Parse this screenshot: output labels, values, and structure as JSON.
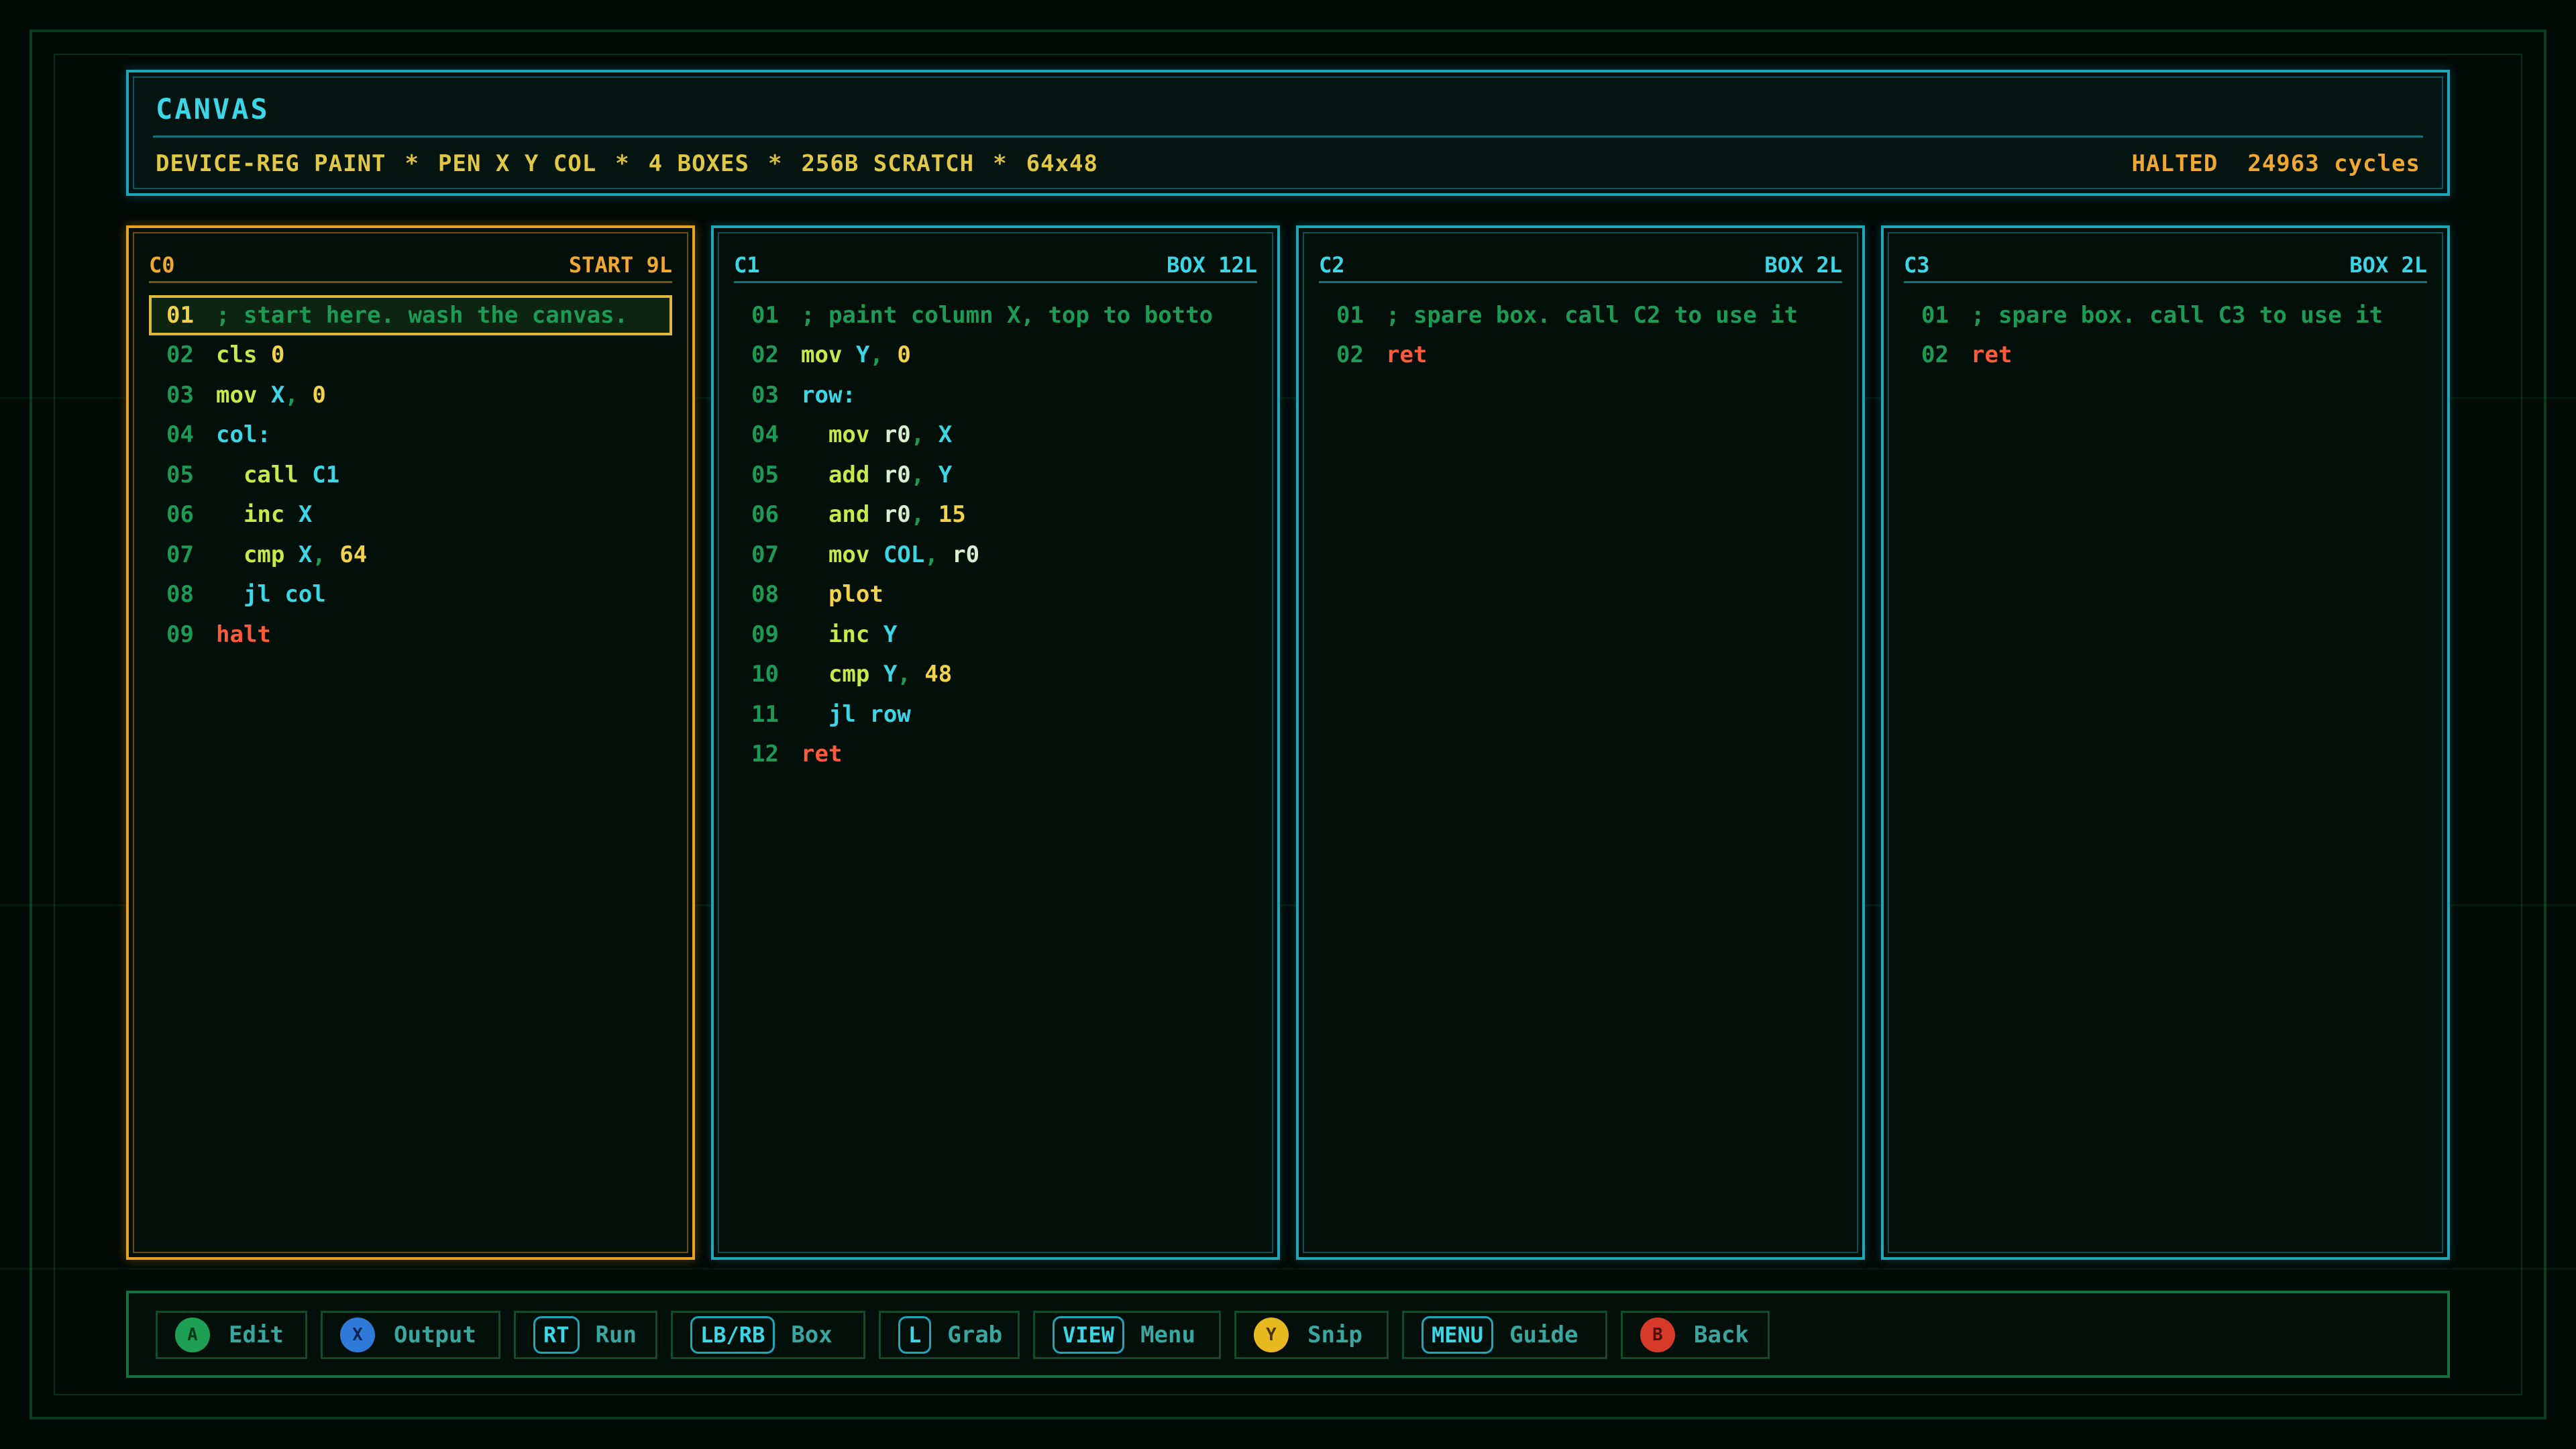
{
  "header": {
    "title": "CANVAS",
    "specs": [
      "DEVICE-REG PAINT",
      "PEN X Y COL",
      "4 BOXES",
      "256B SCRATCH",
      "64x48"
    ],
    "separator": "*",
    "state": "HALTED",
    "cycles": "24963 cycles"
  },
  "panels": [
    {
      "id": "C0",
      "tag": "START 9L",
      "lines": [
        {
          "n": "01",
          "t": [
            [
              "cm",
              "; start here. wash the canvas."
            ]
          ]
        },
        {
          "n": "02",
          "t": [
            [
              "kw",
              "cls "
            ],
            [
              "num",
              "0"
            ]
          ]
        },
        {
          "n": "03",
          "t": [
            [
              "kw",
              "mov "
            ],
            [
              "rg",
              "X"
            ],
            [
              "pu",
              ", "
            ],
            [
              "num",
              "0"
            ]
          ]
        },
        {
          "n": "04",
          "t": [
            [
              "lb",
              "col:"
            ]
          ]
        },
        {
          "n": "05",
          "t": [
            [
              "kw",
              "  call "
            ],
            [
              "lb",
              "C1"
            ]
          ]
        },
        {
          "n": "06",
          "t": [
            [
              "kw",
              "  inc "
            ],
            [
              "rg",
              "X"
            ]
          ]
        },
        {
          "n": "07",
          "t": [
            [
              "kw",
              "  cmp "
            ],
            [
              "rg",
              "X"
            ],
            [
              "pu",
              ", "
            ],
            [
              "num",
              "64"
            ]
          ]
        },
        {
          "n": "08",
          "t": [
            [
              "lb",
              "  jl col"
            ]
          ]
        },
        {
          "n": "09",
          "t": [
            [
              "red",
              "halt"
            ]
          ]
        }
      ]
    },
    {
      "id": "C1",
      "tag": "BOX 12L",
      "lines": [
        {
          "n": "01",
          "t": [
            [
              "cm",
              "; paint column X, top to botto"
            ]
          ]
        },
        {
          "n": "02",
          "t": [
            [
              "kw",
              "mov "
            ],
            [
              "rg",
              "Y"
            ],
            [
              "pu",
              ", "
            ],
            [
              "num",
              "0"
            ]
          ]
        },
        {
          "n": "03",
          "t": [
            [
              "lb",
              "row:"
            ]
          ]
        },
        {
          "n": "04",
          "t": [
            [
              "kw",
              "  mov "
            ],
            [
              "rg2",
              "r0"
            ],
            [
              "pu",
              ", "
            ],
            [
              "rg",
              "X"
            ]
          ]
        },
        {
          "n": "05",
          "t": [
            [
              "kw",
              "  add "
            ],
            [
              "rg2",
              "r0"
            ],
            [
              "pu",
              ", "
            ],
            [
              "rg",
              "Y"
            ]
          ]
        },
        {
          "n": "06",
          "t": [
            [
              "kw",
              "  and "
            ],
            [
              "rg2",
              "r0"
            ],
            [
              "pu",
              ", "
            ],
            [
              "num",
              "15"
            ]
          ]
        },
        {
          "n": "07",
          "t": [
            [
              "kw",
              "  mov "
            ],
            [
              "rg",
              "COL"
            ],
            [
              "pu",
              ", "
            ],
            [
              "rg2",
              "r0"
            ]
          ]
        },
        {
          "n": "08",
          "t": [
            [
              "num",
              "  plot"
            ]
          ]
        },
        {
          "n": "09",
          "t": [
            [
              "kw",
              "  inc "
            ],
            [
              "rg",
              "Y"
            ]
          ]
        },
        {
          "n": "10",
          "t": [
            [
              "kw",
              "  cmp "
            ],
            [
              "rg",
              "Y"
            ],
            [
              "pu",
              ", "
            ],
            [
              "num",
              "48"
            ]
          ]
        },
        {
          "n": "11",
          "t": [
            [
              "lb",
              "  jl row"
            ]
          ]
        },
        {
          "n": "12",
          "t": [
            [
              "red",
              "ret"
            ]
          ]
        }
      ]
    },
    {
      "id": "C2",
      "tag": "BOX 2L",
      "lines": [
        {
          "n": "01",
          "t": [
            [
              "cm",
              "; spare box. call C2 to use it"
            ]
          ]
        },
        {
          "n": "02",
          "t": [
            [
              "red",
              "ret"
            ]
          ]
        }
      ]
    },
    {
      "id": "C3",
      "tag": "BOX 2L",
      "lines": [
        {
          "n": "01",
          "t": [
            [
              "cm",
              "; spare box. call C3 to use it"
            ]
          ]
        },
        {
          "n": "02",
          "t": [
            [
              "red",
              "ret"
            ]
          ]
        }
      ]
    }
  ],
  "footer": {
    "buttons": [
      {
        "glyph": "A",
        "style": "circle-green",
        "label": "Edit"
      },
      {
        "glyph": "X",
        "style": "circle-blue",
        "label": "Output"
      },
      {
        "glyph": "RT",
        "style": "pill",
        "label": "Run"
      },
      {
        "glyph": "LB/RB",
        "style": "pill",
        "label": "Box"
      },
      {
        "glyph": "L",
        "style": "pill",
        "label": "Grab"
      },
      {
        "glyph": "VIEW",
        "style": "pill",
        "label": "Menu"
      },
      {
        "glyph": "Y",
        "style": "circle-yellow",
        "label": "Snip"
      },
      {
        "glyph": "MENU",
        "style": "pill",
        "label": "Guide"
      },
      {
        "glyph": "B",
        "style": "circle-red",
        "label": "Back"
      }
    ]
  },
  "colors": {
    "cyan": "#1fa6b8",
    "amber": "#e8a020",
    "comment": "#1d9a55",
    "number": "#f2d24a",
    "return": "#ff5a3a"
  }
}
